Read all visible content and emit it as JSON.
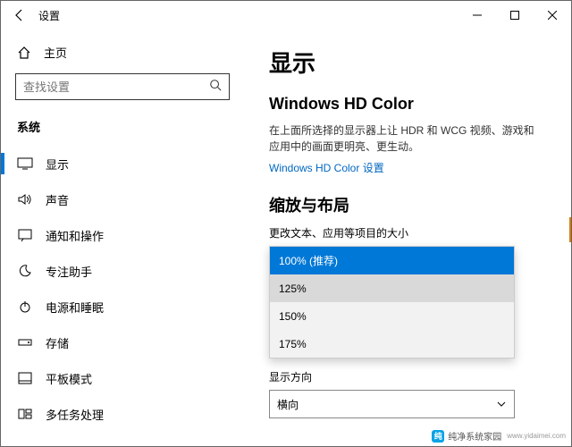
{
  "window": {
    "title": "设置"
  },
  "sidebar": {
    "home": "主页",
    "search_placeholder": "查找设置",
    "section": "系统",
    "items": [
      {
        "label": "显示"
      },
      {
        "label": "声音"
      },
      {
        "label": "通知和操作"
      },
      {
        "label": "专注助手"
      },
      {
        "label": "电源和睡眠"
      },
      {
        "label": "存储"
      },
      {
        "label": "平板模式"
      },
      {
        "label": "多任务处理"
      }
    ]
  },
  "content": {
    "page_title": "显示",
    "hd_heading": "Windows HD Color",
    "hd_desc": "在上面所选择的显示器上让 HDR 和 WCG 视频、游戏和应用中的画面更明亮、更生动。",
    "hd_link": "Windows HD Color 设置",
    "scale_heading": "缩放与布局",
    "scale_label": "更改文本、应用等项目的大小",
    "scale_options": [
      "100% (推荐)",
      "125%",
      "150%",
      "175%"
    ],
    "orientation_label": "显示方向",
    "orientation_value": "横向"
  },
  "watermark": {
    "text": "纯净系统家园",
    "url": "www.yidaimei.com"
  }
}
